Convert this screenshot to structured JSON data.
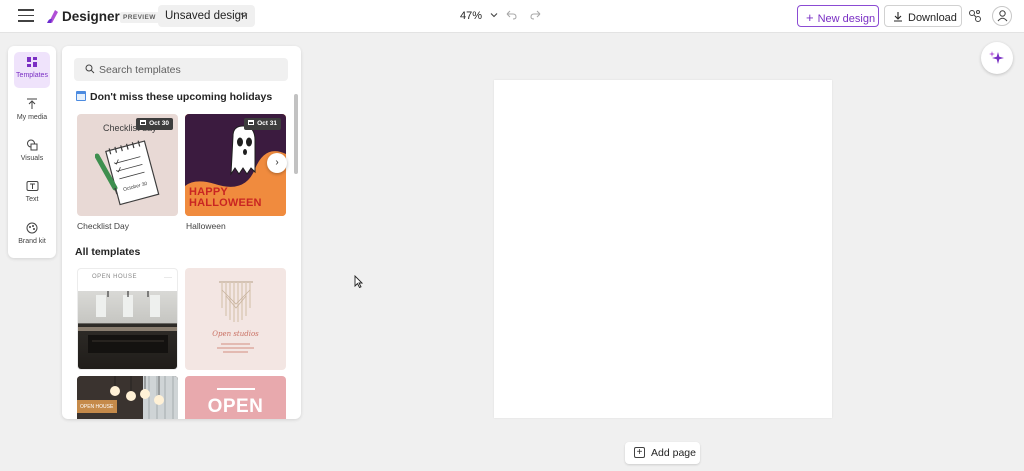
{
  "header": {
    "app_name": "Designer",
    "badge": "PREVIEW",
    "design_title": "Unsaved design",
    "zoom": "47%",
    "new_design_label": "New design",
    "download_label": "Download"
  },
  "rail": {
    "items": [
      {
        "label": "Templates",
        "icon": "templates-icon",
        "active": true
      },
      {
        "label": "My media",
        "icon": "upload-icon"
      },
      {
        "label": "Visuals",
        "icon": "visuals-icon"
      },
      {
        "label": "Text",
        "icon": "text-icon"
      },
      {
        "label": "Brand kit",
        "icon": "brand-kit-icon"
      }
    ]
  },
  "panel": {
    "search_placeholder": "Search templates",
    "holidays_heading": "Don't miss these upcoming holidays",
    "holidays": [
      {
        "title": "Checklist Day",
        "date": "Oct 30",
        "card_text": "Checklist day",
        "card_subtext": "October 30"
      },
      {
        "title": "Halloween",
        "date": "Oct 31",
        "card_text": "HAPPY HALLOWEEN"
      }
    ],
    "all_heading": "All templates",
    "templates": [
      {
        "title": "OPEN HOUSE"
      },
      {
        "title": "Open studios"
      },
      {
        "title": "OPEN HOUSE"
      },
      {
        "title": "OPEN"
      }
    ]
  },
  "canvas": {
    "add_page_label": "Add page"
  },
  "colors": {
    "accent": "#7a2fc4",
    "canvas_bg": "#f0f0f0"
  }
}
